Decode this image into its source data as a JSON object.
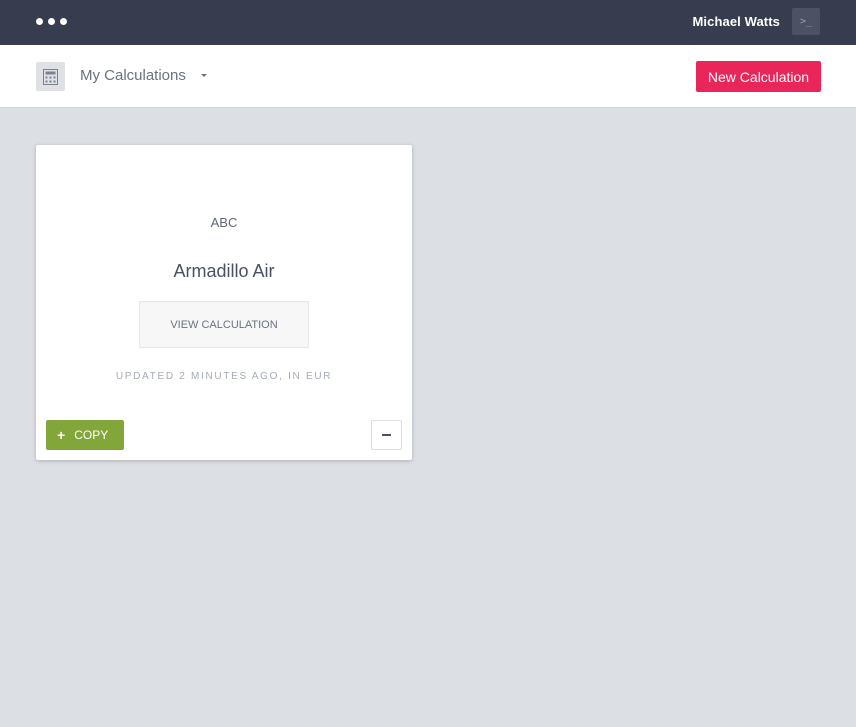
{
  "topbar": {
    "menu_icon": "dots-menu-icon",
    "user_name": "Michael Watts",
    "terminal_icon": "terminal-icon",
    "terminal_glyph": ">_"
  },
  "subbar": {
    "section_icon": "calculator-icon",
    "title": "My Calculations",
    "dropdown_icon": "caret-down-icon",
    "new_button_label": "New Calculation"
  },
  "card": {
    "code": "ABC",
    "name": "Armadillo Air",
    "view_button_label": "VIEW CALCULATION",
    "updated_text": "UPDATED 2 MINUTES AGO, IN EUR",
    "copy_icon": "plus-icon",
    "copy_glyph": "+",
    "copy_label": "COPY",
    "remove_icon": "minus-icon"
  },
  "colors": {
    "topbar_bg": "#363d4f",
    "accent_new": "#e8265a",
    "copy_green": "#83a63a",
    "page_bg": "#dcdfe4"
  }
}
